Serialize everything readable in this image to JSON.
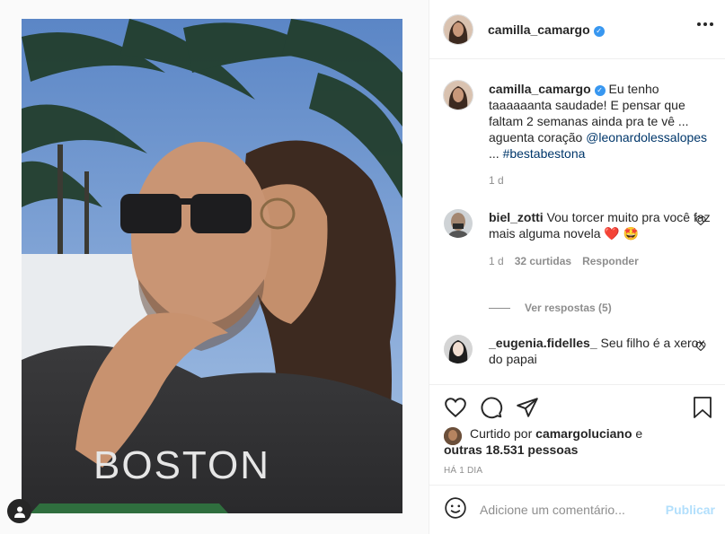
{
  "post": {
    "author": "camilla_camargo",
    "verified": true
  },
  "caption": {
    "username": "camilla_camargo",
    "text": "Eu tenho taaaaaanta saudade! E pensar que faltam 2 semanas ainda pra te vê ... aguenta coração",
    "mention": "@leonardolessalopes",
    "ellipsis": "...",
    "hashtag": "#bestabestona",
    "time": "1 d"
  },
  "comments": [
    {
      "username": "biel_zotti",
      "text": "Vou torcer muito pra você faz mais alguma novela",
      "emoji_1": "❤️",
      "emoji_2": "🤩",
      "time": "1 d",
      "likes": "32 curtidas",
      "reply": "Responder",
      "view_replies": "Ver respostas (5)"
    },
    {
      "username": "_eugenia.fidelles_",
      "text": "Seu filho é a xerox do papai"
    }
  ],
  "likes": {
    "prefix": "Curtido por",
    "user": "camargoluciano",
    "connector": "e",
    "others": "outras 18.531 pessoas"
  },
  "timestamp": "HÁ 1 DIA",
  "comment_box": {
    "placeholder": "Adicione um comentário...",
    "publish_label": "Publicar"
  },
  "icons": {
    "like": "heart-icon",
    "comment": "comment-icon",
    "share": "share-icon",
    "save": "bookmark-icon",
    "emoji": "emoji-icon",
    "more": "more-options-icon",
    "tag": "user-tag-icon"
  },
  "colors": {
    "verified": "#3897f0",
    "link": "#00376b",
    "muted": "#8e8e8e",
    "publish_disabled": "#b2dffc",
    "heart_red": "#ed4956"
  }
}
